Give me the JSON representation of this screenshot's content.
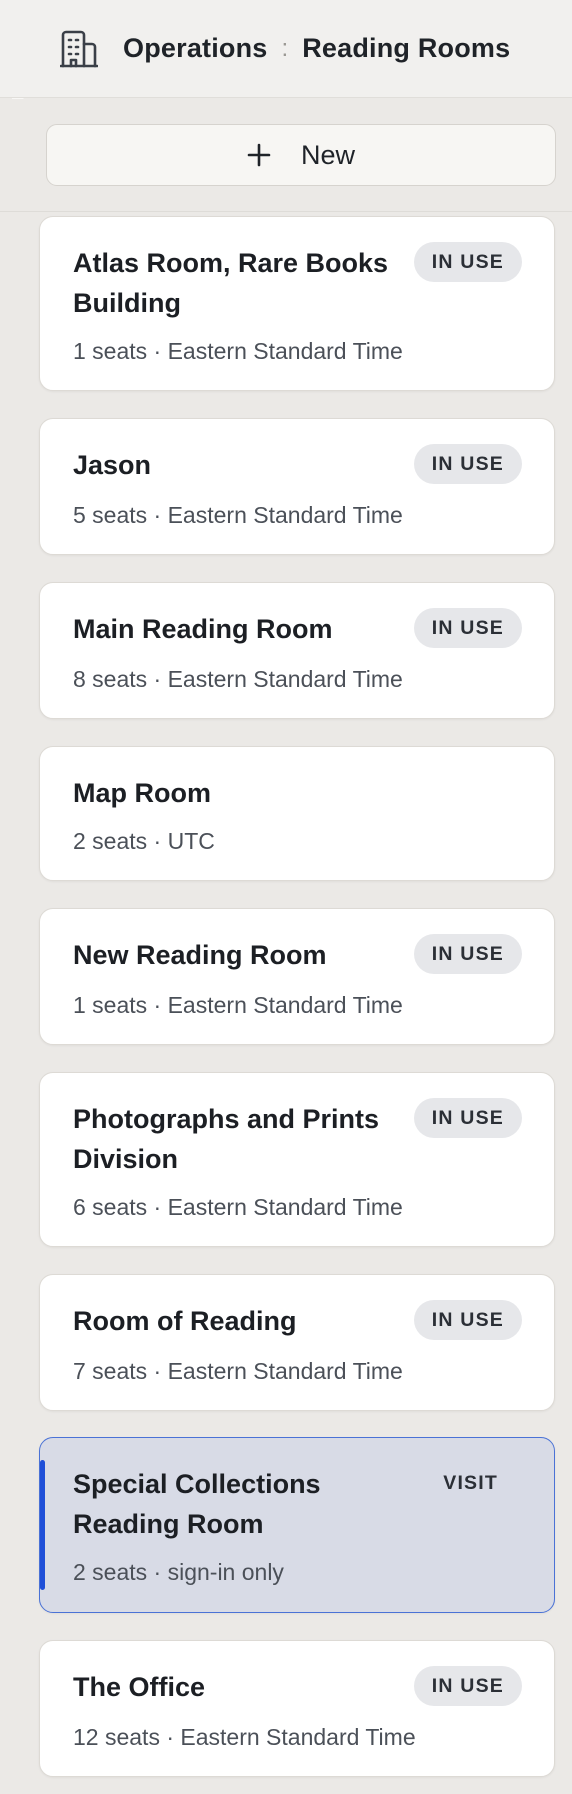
{
  "header": {
    "icon": "building-icon",
    "breadcrumb_root": "Operations",
    "separator": ":",
    "breadcrumb_current": "Reading Rooms"
  },
  "toolbar": {
    "new_label": "New"
  },
  "rooms": [
    {
      "title": "Atlas Room, Rare Books Building",
      "meta": "1 seats · Eastern Standard Time",
      "badge": "IN USE"
    },
    {
      "title": "Jason",
      "meta": "5 seats · Eastern Standard Time",
      "badge": "IN USE"
    },
    {
      "title": "Main Reading Room",
      "meta": "8 seats · Eastern Standard Time",
      "badge": "IN USE"
    },
    {
      "title": "Map Room",
      "meta": "2 seats · UTC",
      "badge": ""
    },
    {
      "title": "New Reading Room",
      "meta": "1 seats · Eastern Standard Time",
      "badge": "IN USE"
    },
    {
      "title": "Photographs and Prints Division",
      "meta": "6 seats · Eastern Standard Time",
      "badge": "IN USE"
    },
    {
      "title": "Room of Reading",
      "meta": "7 seats · Eastern Standard Time",
      "badge": "IN USE"
    },
    {
      "title": "Special Collections Reading Room",
      "meta": "2 seats · sign-in only",
      "badge": "VISIT",
      "selected": true
    },
    {
      "title": "The Office",
      "meta": "12 seats · Eastern Standard Time",
      "badge": "IN USE"
    }
  ],
  "colors": {
    "selected_accent": "#1f4fd8",
    "selected_background": "#d8dbe6",
    "badge_background": "#e6e7ea"
  }
}
